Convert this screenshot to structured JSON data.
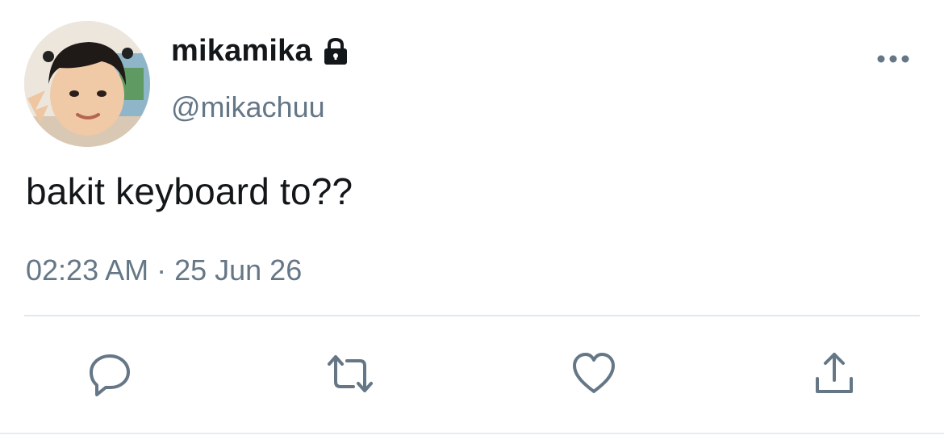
{
  "tweet": {
    "display_name": "mikamika",
    "handle": "@mikachuu",
    "protected_icon": "lock-icon",
    "text": "bakit keyboard to??",
    "timestamp": "02:23 AM · 25 Jun 26"
  },
  "actions": [
    {
      "name": "reply",
      "icon": "reply-icon"
    },
    {
      "name": "retweet",
      "icon": "retweet-icon"
    },
    {
      "name": "like",
      "icon": "heart-icon"
    },
    {
      "name": "share",
      "icon": "share-icon"
    }
  ],
  "more_icon": "ellipsis-icon",
  "colors": {
    "text_primary": "#14171a",
    "text_secondary": "#657786",
    "divider": "#e1e8ed",
    "icon": "#657786"
  }
}
